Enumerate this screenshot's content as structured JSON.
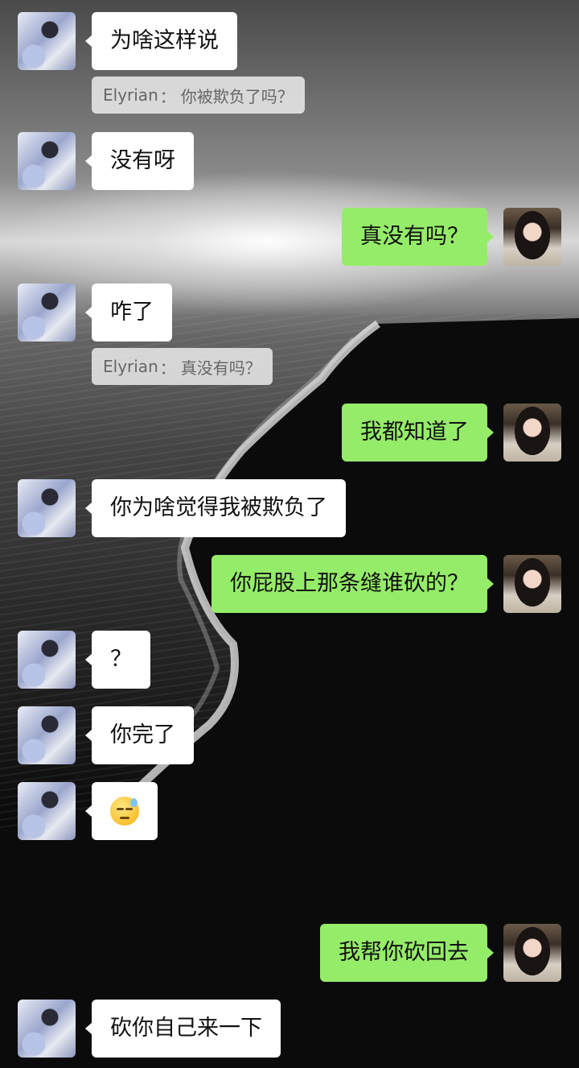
{
  "chat": {
    "messages": [
      {
        "side": "other",
        "text": "为啥这样说"
      },
      {
        "side": "quote",
        "name": "Elyrian",
        "sep": "：",
        "text": "你被欺负了吗？"
      },
      {
        "side": "other",
        "text": "没有呀"
      },
      {
        "side": "me",
        "text": "真没有吗？"
      },
      {
        "side": "other",
        "text": "咋了"
      },
      {
        "side": "quote",
        "name": "Elyrian",
        "sep": "：",
        "text": "真没有吗？"
      },
      {
        "side": "me",
        "text": "我都知道了"
      },
      {
        "side": "other",
        "text": "你为啥觉得我被欺负了"
      },
      {
        "side": "me",
        "text": "你屁股上那条缝谁砍的？"
      },
      {
        "side": "other",
        "text": "？"
      },
      {
        "side": "other",
        "text": "你完了"
      },
      {
        "side": "other",
        "emoji": "sweat-smile-emoji"
      },
      {
        "side": "me",
        "text": "我帮你砍回去"
      },
      {
        "side": "other",
        "text": "砍你自己来一下"
      }
    ]
  },
  "colors": {
    "bubble_me": "#95ec69",
    "bubble_other": "#ffffff",
    "quote_bg": "#f0f0f0",
    "quote_text": "#666666"
  }
}
